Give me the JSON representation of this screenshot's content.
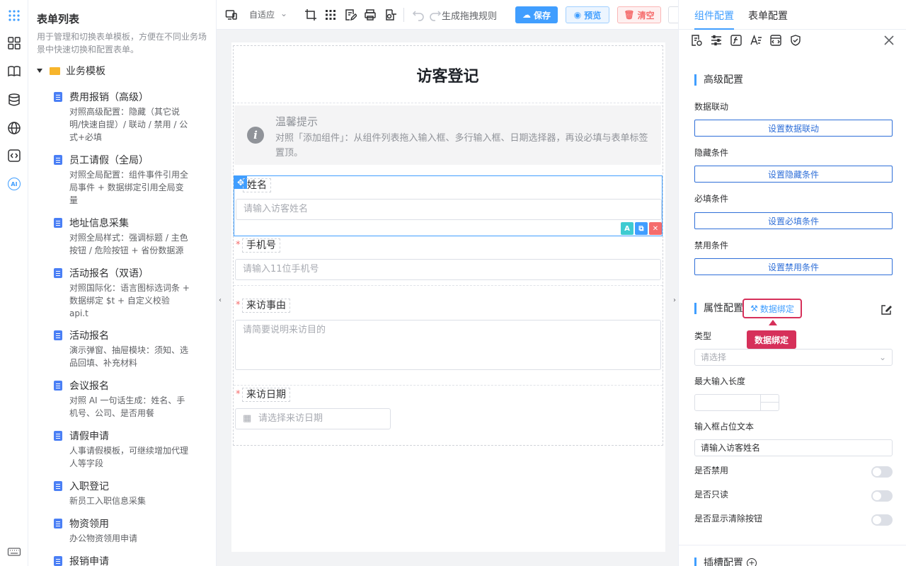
{
  "accent": "#409eff",
  "rail": {
    "icons": [
      "apps-grid-icon",
      "components-icon",
      "book-icon",
      "database-icon",
      "globe-icon",
      "code-icon",
      "ai-icon",
      "keyboard-icon"
    ],
    "ai_label": "AI"
  },
  "template_panel": {
    "title": "表单列表",
    "description": "用于管理和切换表单模板，方便在不同业务场景中快速切换和配置表单。",
    "folder": "业务模板",
    "items": [
      {
        "name": "费用报销（高级）",
        "desc": "对照高级配置：隐藏（其它说明/快速自提）/ 联动 / 禁用 / 公式+必填"
      },
      {
        "name": "员工请假（全局）",
        "desc": "对照全局配置：组件事件引用全局事件 + 数据绑定引用全局变量"
      },
      {
        "name": "地址信息采集",
        "desc": "对照全局样式：强调标题 / 主色按钮 / 危险按钮 + 省份数据源"
      },
      {
        "name": "活动报名（双语）",
        "desc": "对照国际化：语言图标选词条 + 数据绑定 $t + 自定义校验 api.t"
      },
      {
        "name": "活动报名",
        "desc": "演示弹窗、抽屉模块：须知、选品回填、补充材料"
      },
      {
        "name": "会议报名",
        "desc": "对照 AI 一句话生成：姓名、手机号、公司、是否用餐"
      },
      {
        "name": "请假申请",
        "desc": "人事请假模板，可继续增加代理人等字段"
      },
      {
        "name": "入职登记",
        "desc": "新员工入职信息采集"
      },
      {
        "name": "物资领用",
        "desc": "办公物资领用申请"
      },
      {
        "name": "报销申请",
        "desc": ""
      }
    ]
  },
  "toolbar": {
    "layout_mode": "自适应",
    "rules_label": "生成拖拽规则",
    "save": "保存",
    "preview": "预览",
    "clear": "清空"
  },
  "form": {
    "title": "访客登记",
    "tip_title": "温馨提示",
    "tip_body": "对照「添加组件」：从组件列表拖入输入框、多行输入框、日期选择器，再设必填与表单标签置顶。",
    "fields": [
      {
        "label": "姓名",
        "placeholder": "请输入访客姓名",
        "required": false
      },
      {
        "label": "手机号",
        "placeholder": "请输入11位手机号",
        "required": true
      },
      {
        "label": "来访事由",
        "placeholder": "请简要说明来访目的",
        "required": true
      },
      {
        "label": "来访日期",
        "placeholder": "请选择来访日期",
        "required": true
      }
    ],
    "required_mark": "*"
  },
  "right_panel": {
    "tabs": [
      "组件配置",
      "表单配置"
    ],
    "advanced_title": "高级配置",
    "linkage_label": "数据联动",
    "linkage_btn": "设置数据联动",
    "hidden_label": "隐藏条件",
    "hidden_btn": "设置隐藏条件",
    "required_label": "必填条件",
    "required_btn": "设置必填条件",
    "disabled_label": "禁用条件",
    "disabled_btn": "设置禁用条件",
    "props_title": "属性配置",
    "binding_btn": "数据绑定",
    "binding_tooltip": "数据绑定",
    "type_label": "类型",
    "type_placeholder": "请选择",
    "maxlen_label": "最大输入长度",
    "placeholder_label": "输入框占位文本",
    "placeholder_value": "请输入访客姓名",
    "disabled_switch": "是否禁用",
    "readonly_switch": "是否只读",
    "clearable_switch": "是否显示清除按钮",
    "slot_title": "插槽配置"
  }
}
